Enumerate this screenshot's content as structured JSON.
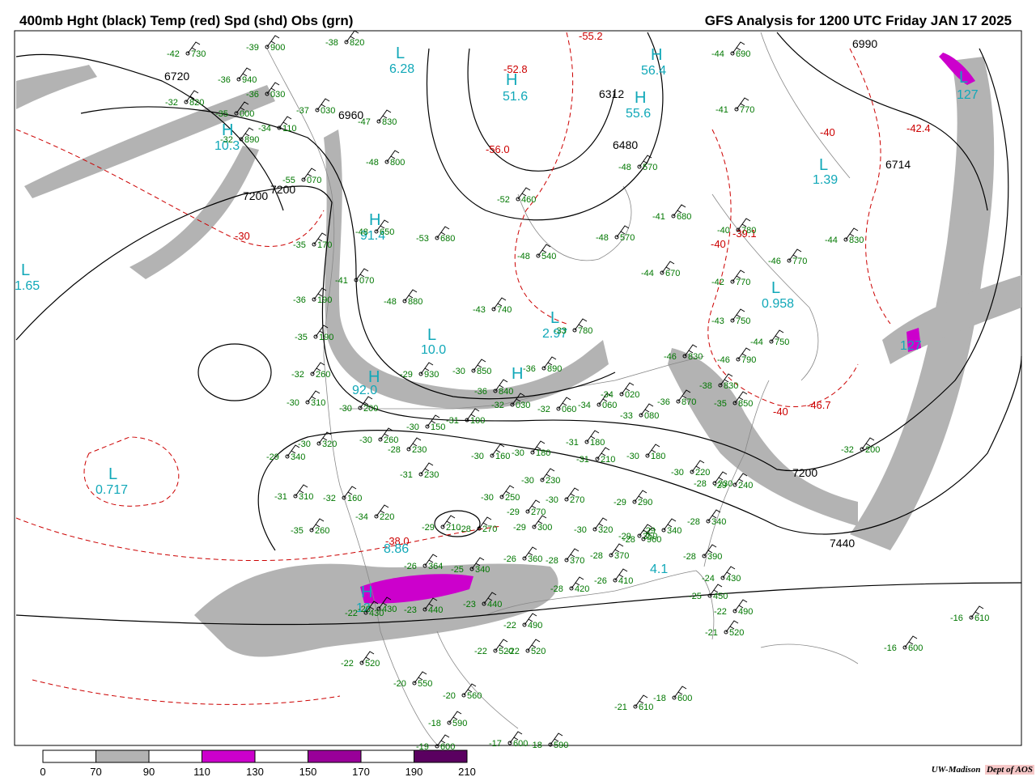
{
  "header": {
    "left_title": "400mb Hght (black) Temp (red) Spd (shd) Obs (grn)",
    "right_title": "GFS Analysis for 1200 UTC Friday  JAN 17 2025"
  },
  "credit": {
    "org": "UW-Madison",
    "dept": "Dept of AOS"
  },
  "colors": {
    "height": "#000000",
    "temp": "#cc0000",
    "obs": "#007700",
    "speed_label": "#11a8b8",
    "shade_70": "#b3b3b3",
    "shade_110": "#cc00cc",
    "shade_150": "#990099",
    "shade_190": "#5a0060"
  },
  "colorbar": {
    "ticks": [
      "0",
      "70",
      "90",
      "110",
      "130",
      "150",
      "170",
      "190",
      "210"
    ],
    "fills": [
      "#ffffff",
      "#b3b3b3",
      "#ffffff",
      "#cc00cc",
      "#ffffff",
      "#990099",
      "#ffffff",
      "#5a0060"
    ]
  },
  "height_labels": [
    "6720",
    "6960",
    "7200",
    "7200",
    "6480",
    "6714",
    "6990",
    "7200",
    "7440",
    "6312"
  ],
  "temp_labels": [
    "-30",
    "-40",
    "-40",
    "-42.4",
    "-40",
    "-39.1",
    "-46.7",
    "-52.8",
    "-55.2",
    "-56.0",
    "-38.0"
  ],
  "speed_labels": [
    "6.28",
    "51.6",
    "56.4",
    "55.6",
    "127",
    "1.65",
    "1.39",
    "0.958",
    "10.0",
    "2.97",
    "92.0",
    "0.717",
    "8.86",
    "127",
    "10.3",
    "91.4",
    "4.1",
    "12"
  ],
  "pressure_centers": [
    "L",
    "L",
    "L",
    "L",
    "L",
    "L",
    "L",
    "L",
    "H",
    "H",
    "H",
    "H",
    "H",
    "H",
    "H",
    "H"
  ],
  "obs": [
    {
      "t": "-42",
      "h": "730"
    },
    {
      "t": "-39",
      "h": "900"
    },
    {
      "t": "-38",
      "h": "820"
    },
    {
      "t": "-36",
      "h": "940"
    },
    {
      "t": "-32",
      "h": "820"
    },
    {
      "t": "-36",
      "h": "030"
    },
    {
      "t": "-37",
      "h": "030"
    },
    {
      "t": "-35",
      "h": "000"
    },
    {
      "t": "-34",
      "h": "110"
    },
    {
      "t": "-32",
      "h": "890"
    },
    {
      "t": "-47",
      "h": "830"
    },
    {
      "t": "-48",
      "h": "800"
    },
    {
      "t": "-55",
      "h": "070"
    },
    {
      "t": "-44",
      "h": "690"
    },
    {
      "t": "-41",
      "h": "770"
    },
    {
      "t": "-48",
      "h": "570"
    },
    {
      "t": "-52",
      "h": "460"
    },
    {
      "t": "-41",
      "h": "680"
    },
    {
      "t": "-40",
      "h": "780"
    },
    {
      "t": "-44",
      "h": "830"
    },
    {
      "t": "-46",
      "h": "770"
    },
    {
      "t": "-42",
      "h": "770"
    },
    {
      "t": "-44",
      "h": "670"
    },
    {
      "t": "-48",
      "h": "570"
    },
    {
      "t": "-53",
      "h": "680"
    },
    {
      "t": "-48",
      "h": "650"
    },
    {
      "t": "-48",
      "h": "540"
    },
    {
      "t": "-35",
      "h": "170"
    },
    {
      "t": "-41",
      "h": "070"
    },
    {
      "t": "-48",
      "h": "880"
    },
    {
      "t": "-43",
      "h": "740"
    },
    {
      "t": "-33",
      "h": "780"
    },
    {
      "t": "-36",
      "h": "190"
    },
    {
      "t": "-35",
      "h": "190"
    },
    {
      "t": "-32",
      "h": "260"
    },
    {
      "t": "-30",
      "h": "310"
    },
    {
      "t": "-30",
      "h": "200"
    },
    {
      "t": "-29",
      "h": "930"
    },
    {
      "t": "-30",
      "h": "850"
    },
    {
      "t": "-36",
      "h": "890"
    },
    {
      "t": "-36",
      "h": "840"
    },
    {
      "t": "-32",
      "h": "030"
    },
    {
      "t": "-32",
      "h": "060"
    },
    {
      "t": "-34",
      "h": "060"
    },
    {
      "t": "-34",
      "h": "020"
    },
    {
      "t": "-33",
      "h": "080"
    },
    {
      "t": "-43",
      "h": "750"
    },
    {
      "t": "-44",
      "h": "750"
    },
    {
      "t": "-46",
      "h": "790"
    },
    {
      "t": "-46",
      "h": "830"
    },
    {
      "t": "-38",
      "h": "830"
    },
    {
      "t": "-35",
      "h": "850"
    },
    {
      "t": "-36",
      "h": "870"
    },
    {
      "t": "-30",
      "h": "320"
    },
    {
      "t": "-30",
      "h": "260"
    },
    {
      "t": "-28",
      "h": "230"
    },
    {
      "t": "-30",
      "h": "150"
    },
    {
      "t": "-31",
      "h": "100"
    },
    {
      "t": "-29",
      "h": "340"
    },
    {
      "t": "-31",
      "h": "310"
    },
    {
      "t": "-32",
      "h": "160"
    },
    {
      "t": "-31",
      "h": "230"
    },
    {
      "t": "-30",
      "h": "160"
    },
    {
      "t": "-30",
      "h": "180"
    },
    {
      "t": "-31",
      "h": "180"
    },
    {
      "t": "-31",
      "h": "210"
    },
    {
      "t": "-30",
      "h": "180"
    },
    {
      "t": "-30",
      "h": "230"
    },
    {
      "t": "-30",
      "h": "250"
    },
    {
      "t": "-30",
      "h": "270"
    },
    {
      "t": "-29",
      "h": "290"
    },
    {
      "t": "-30",
      "h": "220"
    },
    {
      "t": "-28",
      "h": "230"
    },
    {
      "t": "-29",
      "h": "240"
    },
    {
      "t": "-28",
      "h": "960"
    },
    {
      "t": "-32",
      "h": "200"
    },
    {
      "t": "-34",
      "h": "220"
    },
    {
      "t": "-35",
      "h": "260"
    },
    {
      "t": "-29",
      "h": "210"
    },
    {
      "t": "-28",
      "h": "270"
    },
    {
      "t": "-29",
      "h": "270"
    },
    {
      "t": "-29",
      "h": "300"
    },
    {
      "t": "-30",
      "h": "320"
    },
    {
      "t": "-29",
      "h": "340"
    },
    {
      "t": "-29",
      "h": "350"
    },
    {
      "t": "-28",
      "h": "340"
    },
    {
      "t": "-26",
      "h": "360"
    },
    {
      "t": "-28",
      "h": "370"
    },
    {
      "t": "-28",
      "h": "370"
    },
    {
      "t": "-26",
      "h": "364"
    },
    {
      "t": "-25",
      "h": "340"
    },
    {
      "t": "-28",
      "h": "390"
    },
    {
      "t": "-24",
      "h": "430"
    },
    {
      "t": "-25",
      "h": "450"
    },
    {
      "t": "-22",
      "h": "490"
    },
    {
      "t": "-21",
      "h": "520"
    },
    {
      "t": "-28",
      "h": "420"
    },
    {
      "t": "-26",
      "h": "410"
    },
    {
      "t": "-22",
      "h": "430"
    },
    {
      "t": "-23",
      "h": "440"
    },
    {
      "t": "-23",
      "h": "440"
    },
    {
      "t": "-22",
      "h": "490"
    },
    {
      "t": "-22",
      "h": "520"
    },
    {
      "t": "-22",
      "h": "520"
    },
    {
      "t": "-22",
      "h": "520"
    },
    {
      "t": "-20",
      "h": "550"
    },
    {
      "t": "-20",
      "h": "560"
    },
    {
      "t": "-18",
      "h": "590"
    },
    {
      "t": "-19",
      "h": "600"
    },
    {
      "t": "-17",
      "h": "600"
    },
    {
      "t": "-18",
      "h": "590"
    },
    {
      "t": "-18",
      "h": "600"
    },
    {
      "t": "-21",
      "h": "610"
    },
    {
      "t": "-16",
      "h": "610"
    },
    {
      "t": "-16",
      "h": "600"
    },
    {
      "t": "-20",
      "h": "430"
    }
  ]
}
